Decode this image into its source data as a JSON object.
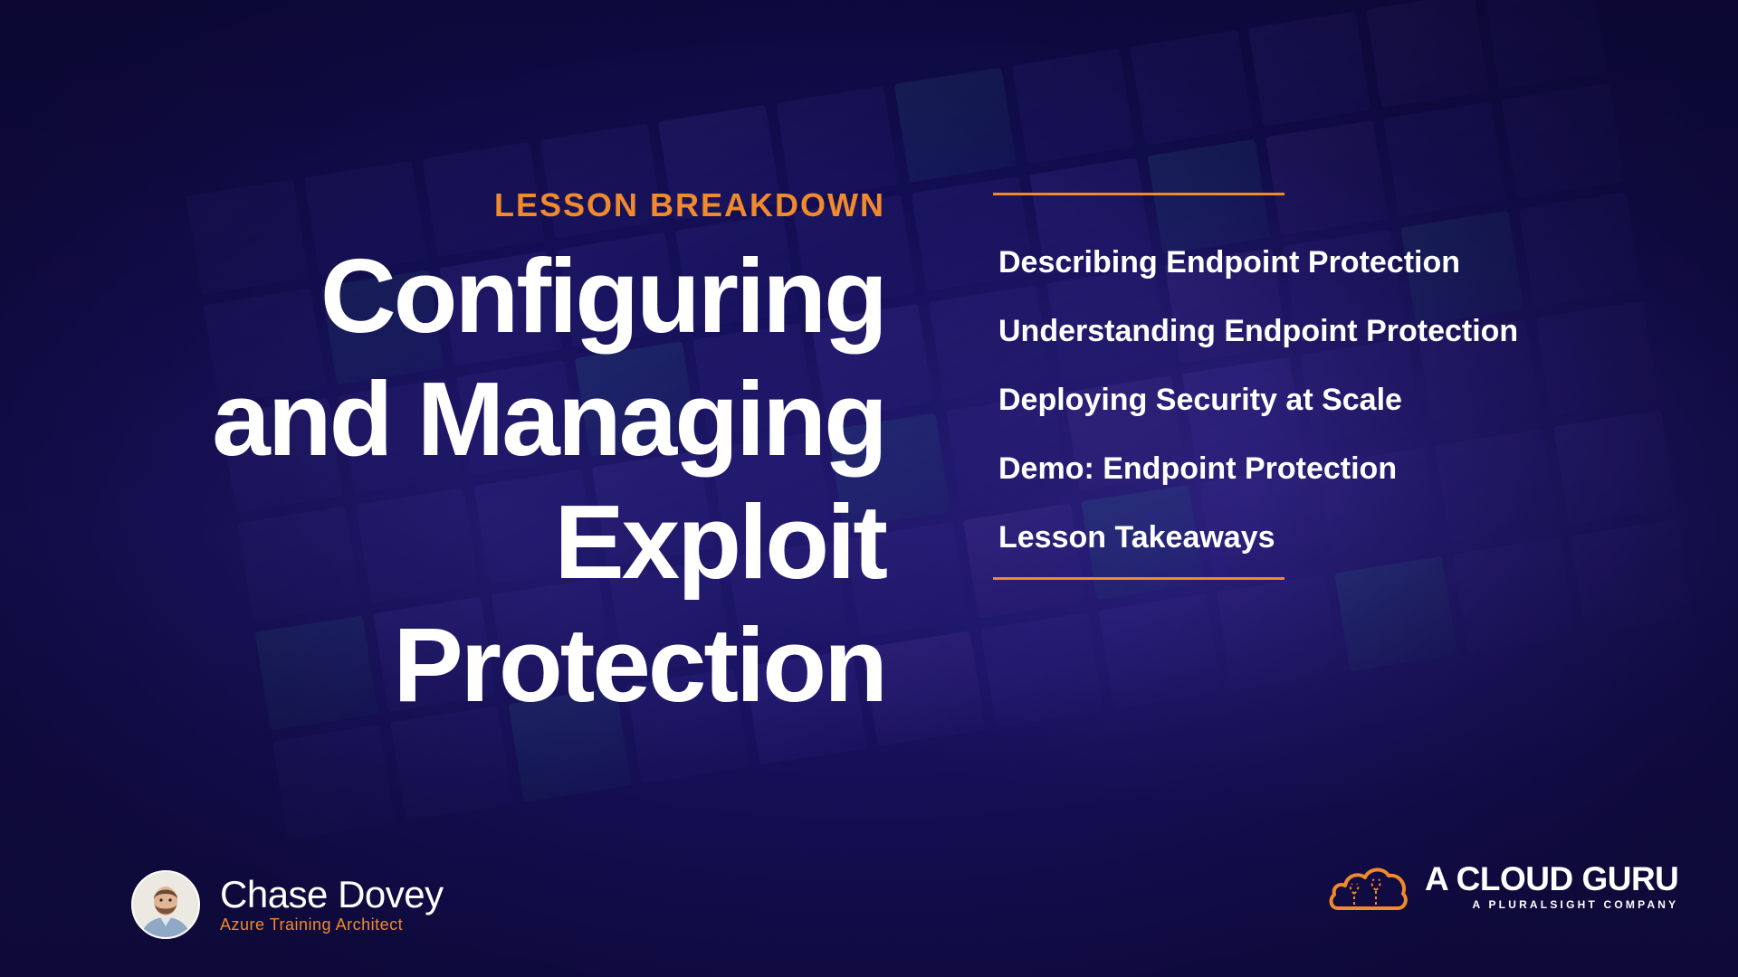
{
  "slide": {
    "eyebrow": "LESSON BREAKDOWN",
    "title_lines": [
      "Configuring",
      "and Managing",
      "Exploit",
      "Protection"
    ],
    "topics": [
      "Describing Endpoint Protection",
      "Understanding Endpoint Protection",
      "Deploying Security at Scale",
      "Demo: Endpoint Protection",
      "Lesson Takeaways"
    ]
  },
  "presenter": {
    "name": "Chase Dovey",
    "role": "Azure Training Architect"
  },
  "brand": {
    "name": "A CLOUD GURU",
    "tagline": "A PLURALSIGHT COMPANY",
    "logo_icon": "cloud-logo-icon"
  },
  "colors": {
    "accent": "#f08a2c",
    "background": "#150f58",
    "text": "#ffffff"
  }
}
